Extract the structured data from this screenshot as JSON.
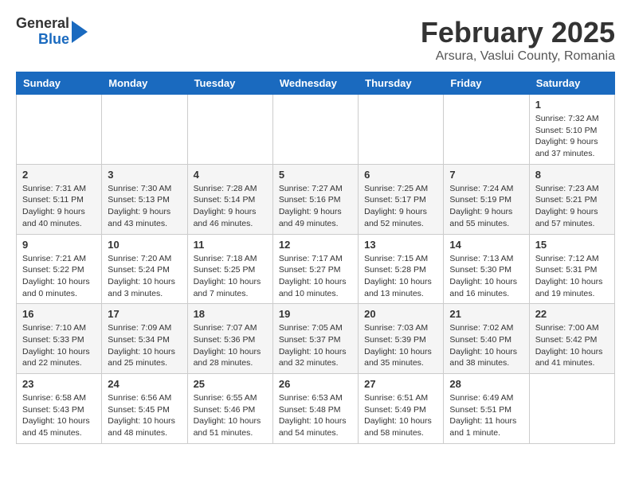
{
  "header": {
    "logo_general": "General",
    "logo_blue": "Blue",
    "month_title": "February 2025",
    "subtitle": "Arsura, Vaslui County, Romania"
  },
  "weekdays": [
    "Sunday",
    "Monday",
    "Tuesday",
    "Wednesday",
    "Thursday",
    "Friday",
    "Saturday"
  ],
  "weeks": [
    [
      {
        "day": "",
        "info": ""
      },
      {
        "day": "",
        "info": ""
      },
      {
        "day": "",
        "info": ""
      },
      {
        "day": "",
        "info": ""
      },
      {
        "day": "",
        "info": ""
      },
      {
        "day": "",
        "info": ""
      },
      {
        "day": "1",
        "info": "Sunrise: 7:32 AM\nSunset: 5:10 PM\nDaylight: 9 hours and 37 minutes."
      }
    ],
    [
      {
        "day": "2",
        "info": "Sunrise: 7:31 AM\nSunset: 5:11 PM\nDaylight: 9 hours and 40 minutes."
      },
      {
        "day": "3",
        "info": "Sunrise: 7:30 AM\nSunset: 5:13 PM\nDaylight: 9 hours and 43 minutes."
      },
      {
        "day": "4",
        "info": "Sunrise: 7:28 AM\nSunset: 5:14 PM\nDaylight: 9 hours and 46 minutes."
      },
      {
        "day": "5",
        "info": "Sunrise: 7:27 AM\nSunset: 5:16 PM\nDaylight: 9 hours and 49 minutes."
      },
      {
        "day": "6",
        "info": "Sunrise: 7:25 AM\nSunset: 5:17 PM\nDaylight: 9 hours and 52 minutes."
      },
      {
        "day": "7",
        "info": "Sunrise: 7:24 AM\nSunset: 5:19 PM\nDaylight: 9 hours and 55 minutes."
      },
      {
        "day": "8",
        "info": "Sunrise: 7:23 AM\nSunset: 5:21 PM\nDaylight: 9 hours and 57 minutes."
      }
    ],
    [
      {
        "day": "9",
        "info": "Sunrise: 7:21 AM\nSunset: 5:22 PM\nDaylight: 10 hours and 0 minutes."
      },
      {
        "day": "10",
        "info": "Sunrise: 7:20 AM\nSunset: 5:24 PM\nDaylight: 10 hours and 3 minutes."
      },
      {
        "day": "11",
        "info": "Sunrise: 7:18 AM\nSunset: 5:25 PM\nDaylight: 10 hours and 7 minutes."
      },
      {
        "day": "12",
        "info": "Sunrise: 7:17 AM\nSunset: 5:27 PM\nDaylight: 10 hours and 10 minutes."
      },
      {
        "day": "13",
        "info": "Sunrise: 7:15 AM\nSunset: 5:28 PM\nDaylight: 10 hours and 13 minutes."
      },
      {
        "day": "14",
        "info": "Sunrise: 7:13 AM\nSunset: 5:30 PM\nDaylight: 10 hours and 16 minutes."
      },
      {
        "day": "15",
        "info": "Sunrise: 7:12 AM\nSunset: 5:31 PM\nDaylight: 10 hours and 19 minutes."
      }
    ],
    [
      {
        "day": "16",
        "info": "Sunrise: 7:10 AM\nSunset: 5:33 PM\nDaylight: 10 hours and 22 minutes."
      },
      {
        "day": "17",
        "info": "Sunrise: 7:09 AM\nSunset: 5:34 PM\nDaylight: 10 hours and 25 minutes."
      },
      {
        "day": "18",
        "info": "Sunrise: 7:07 AM\nSunset: 5:36 PM\nDaylight: 10 hours and 28 minutes."
      },
      {
        "day": "19",
        "info": "Sunrise: 7:05 AM\nSunset: 5:37 PM\nDaylight: 10 hours and 32 minutes."
      },
      {
        "day": "20",
        "info": "Sunrise: 7:03 AM\nSunset: 5:39 PM\nDaylight: 10 hours and 35 minutes."
      },
      {
        "day": "21",
        "info": "Sunrise: 7:02 AM\nSunset: 5:40 PM\nDaylight: 10 hours and 38 minutes."
      },
      {
        "day": "22",
        "info": "Sunrise: 7:00 AM\nSunset: 5:42 PM\nDaylight: 10 hours and 41 minutes."
      }
    ],
    [
      {
        "day": "23",
        "info": "Sunrise: 6:58 AM\nSunset: 5:43 PM\nDaylight: 10 hours and 45 minutes."
      },
      {
        "day": "24",
        "info": "Sunrise: 6:56 AM\nSunset: 5:45 PM\nDaylight: 10 hours and 48 minutes."
      },
      {
        "day": "25",
        "info": "Sunrise: 6:55 AM\nSunset: 5:46 PM\nDaylight: 10 hours and 51 minutes."
      },
      {
        "day": "26",
        "info": "Sunrise: 6:53 AM\nSunset: 5:48 PM\nDaylight: 10 hours and 54 minutes."
      },
      {
        "day": "27",
        "info": "Sunrise: 6:51 AM\nSunset: 5:49 PM\nDaylight: 10 hours and 58 minutes."
      },
      {
        "day": "28",
        "info": "Sunrise: 6:49 AM\nSunset: 5:51 PM\nDaylight: 11 hours and 1 minute."
      },
      {
        "day": "",
        "info": ""
      }
    ]
  ]
}
